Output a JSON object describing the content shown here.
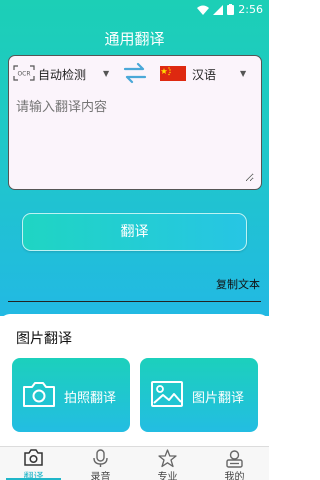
{
  "status_bar": {
    "time": "2:56"
  },
  "header": {
    "title": "通用翻译"
  },
  "translator": {
    "ocr_icon_text": "OCR",
    "source_language": "自动检测",
    "target_language": "汉语",
    "input_placeholder": "请输入翻译内容",
    "translate_label": "翻译",
    "copy_label": "复制文本"
  },
  "image_translate": {
    "section_title": "图片翻译",
    "photo_label": "拍照翻译",
    "picture_label": "图片翻译"
  },
  "bottom_nav": {
    "items": [
      {
        "label": "翻译",
        "icon": "camera-icon",
        "active": true
      },
      {
        "label": "录音",
        "icon": "microphone-icon"
      },
      {
        "label": "专业",
        "icon": "star-icon"
      },
      {
        "label": "我的",
        "icon": "profile-icon"
      }
    ]
  },
  "colors": {
    "accent": "#1fc9c6",
    "accent_blue": "#22b9e3",
    "active_tab": "#1fb6c9"
  }
}
